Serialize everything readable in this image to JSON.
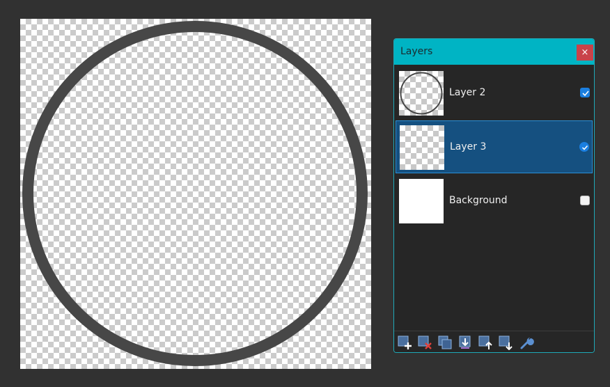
{
  "canvas": {
    "ring_color": "#474747"
  },
  "layers_panel": {
    "title": "Layers",
    "close_label": "×",
    "layers": [
      {
        "name": "Layer 2",
        "thumbnail": "ring-on-transparent",
        "visible": true,
        "selected": false
      },
      {
        "name": "Layer 3",
        "thumbnail": "transparent",
        "visible": true,
        "selected": true
      },
      {
        "name": "Background",
        "thumbnail": "white",
        "visible": false,
        "selected": false
      }
    ],
    "footer_tools": [
      "add-layer-icon",
      "delete-layer-icon",
      "duplicate-layer-icon",
      "merge-layer-down-icon",
      "move-layer-up-icon",
      "move-layer-down-icon",
      "layer-properties-icon"
    ]
  },
  "colors": {
    "panel_accent": "#00b4c4",
    "selected_row": "#155080",
    "close_button": "#c9434a",
    "checkbox_on": "#1b7fe0"
  }
}
